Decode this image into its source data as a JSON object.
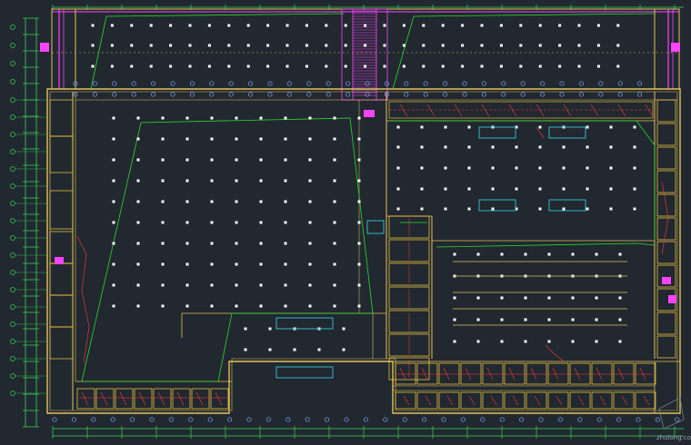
{
  "drawing": {
    "type": "cad-floor-plan",
    "background_color": "#212830",
    "watermark": "zhulong.com",
    "colors": {
      "wall": "#e6c15a",
      "axis": "#7fb0ff",
      "dim": "#39d353",
      "column": "#ffffff",
      "fire": "#ff3b3b",
      "pipe": "#ff44ff",
      "equip": "#33c6d8",
      "route": "#2bd92b",
      "room": "#ffd23f"
    },
    "axis_label_top": "①",
    "axis_label_left": "Ⓐ"
  }
}
